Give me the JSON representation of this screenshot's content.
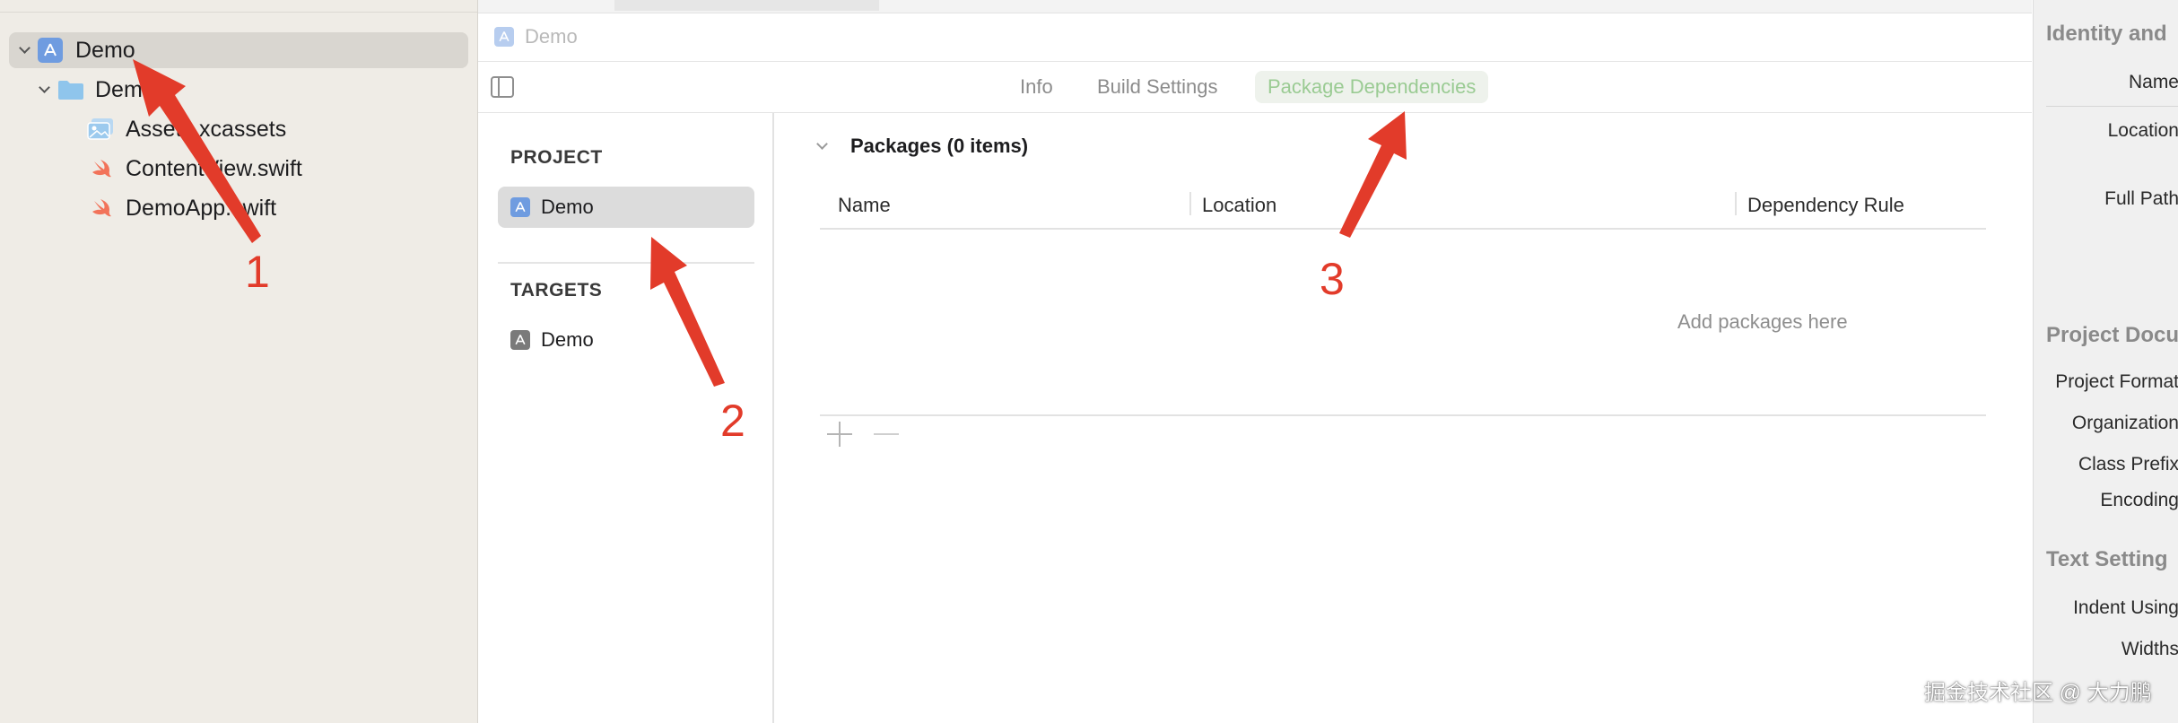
{
  "navigator": {
    "project_label": "Demo",
    "folder_label": "Demo",
    "files": [
      "Assets.xcassets",
      "ContentView.swift",
      "DemoApp.swift"
    ]
  },
  "editor": {
    "jumpbar_label": "Demo",
    "tabs": [
      "Info",
      "Build Settings",
      "Package Dependencies"
    ],
    "active_tab": "Package Dependencies"
  },
  "targets_pane": {
    "project_heading": "PROJECT",
    "project_item": "Demo",
    "targets_heading": "TARGETS",
    "target_item": "Demo"
  },
  "packages": {
    "title": "Packages (0 items)",
    "columns": [
      "Name",
      "Location",
      "Dependency Rule"
    ],
    "empty_text": "Add packages here"
  },
  "inspector": {
    "identity_heading": "Identity and",
    "labels_identity": [
      "Name",
      "Location",
      "Full Path"
    ],
    "project_doc_heading": "Project Docu",
    "labels_project_doc": [
      "Project Format",
      "Organization",
      "Class Prefix",
      "Encoding"
    ],
    "text_settings_heading": "Text Setting",
    "labels_text": [
      "Indent Using",
      "Widths"
    ]
  },
  "annotations": [
    "1",
    "2",
    "3"
  ],
  "watermark": "掘金技术社区 @ 大力鹏",
  "colors": {
    "annotation_red": "#e23b2a",
    "active_tab_text": "#9acb93",
    "project_icon_blue": "#6f9ce0"
  }
}
